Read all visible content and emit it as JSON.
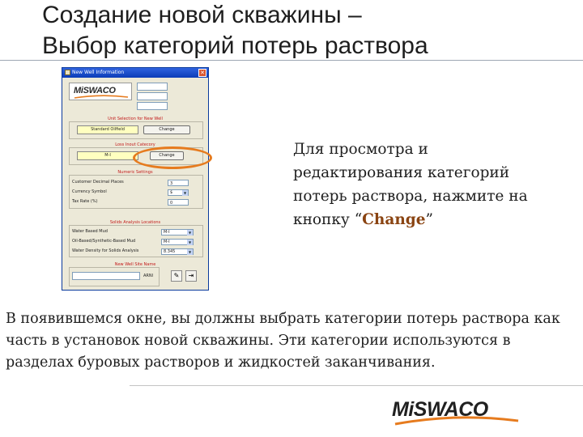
{
  "slide": {
    "title_line1": "Создание новой скважины –",
    "title_line2": "Выбор категорий потерь раствора"
  },
  "dialog": {
    "title": "New Well Information",
    "close_glyph": "✕",
    "logo_text": "MiSWACO",
    "unit_group_title": "Unit Selection for New Well",
    "unit_value": "Standard Oilfield",
    "unit_change": "Change",
    "loss_group_title": "Loss Inout Catecory",
    "loss_value": "M-I",
    "loss_change": "Change",
    "numeric_group_title": "Numeric Settings",
    "numeric_rows": [
      {
        "label": "Customer Decimal Places",
        "value": "3"
      },
      {
        "label": "Currency Symbol",
        "value": "$"
      },
      {
        "label": "Tax Rate (%)",
        "value": "0"
      }
    ],
    "solids_group_title": "Solids Analysis Locations",
    "solids_rows": [
      {
        "label": "Water Based Mud",
        "value": "M-I"
      },
      {
        "label": "Oil-Based/Synthetic-Based Mud",
        "value": "M-I"
      },
      {
        "label": "Water Density for Solids Analysis",
        "value": "8.345"
      }
    ],
    "name_group_title": "New Well Site Name",
    "name_unit": "ARNI"
  },
  "callout": {
    "text_before": "Для просмотра и редактирования категорий потерь раствора, нажмите на кнопку “",
    "change_word": "Change",
    "text_after": "”"
  },
  "body": {
    "paragraph": "В появившемся окне, вы должны выбрать категории потерь раствора как часть в установок новой скважины. Эти категории используются в разделах буровых растворов и жидкостей заканчивания."
  },
  "footer": {
    "logo_text": "MiSWACO"
  },
  "colors": {
    "accent_orange": "#e67b1e",
    "change_word": "#8a4412",
    "group_title_red": "#c21818",
    "titlebar_blue": "#0b3cb7"
  }
}
